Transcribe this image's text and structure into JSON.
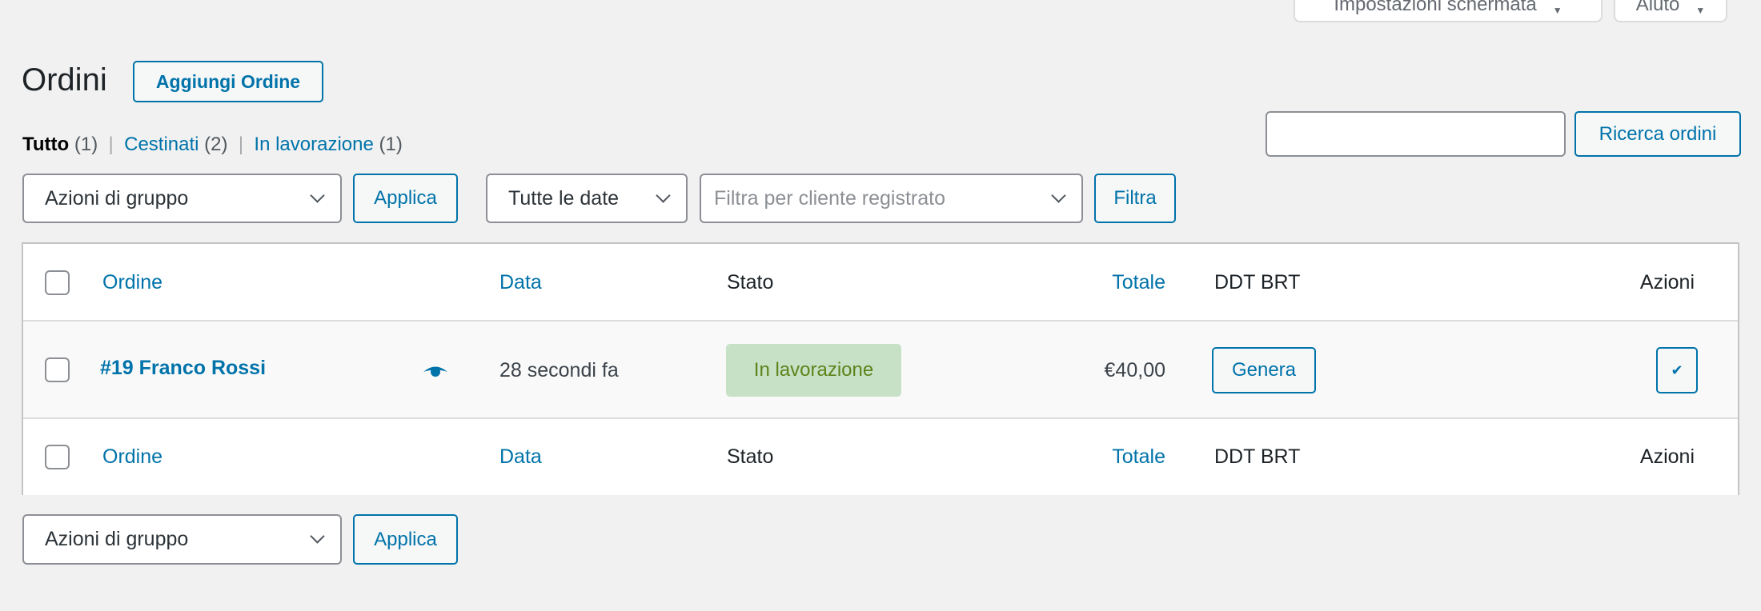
{
  "top_tabs": {
    "screen_options": "Impostazioni schermata",
    "help": "Aiuto"
  },
  "header": {
    "title": "Ordini",
    "add_button": "Aggiungi Ordine"
  },
  "views": [
    {
      "label": "Tutto",
      "count": "(1)",
      "current": true
    },
    {
      "label": "Cestinati",
      "count": "(2)"
    },
    {
      "label": "In lavorazione",
      "count": "(1)"
    }
  ],
  "search": {
    "value": "",
    "button": "Ricerca ordini"
  },
  "filters": {
    "bulk_action": "Azioni di gruppo",
    "apply": "Applica",
    "date": "Tutte le date",
    "customer_placeholder": "Filtra per cliente registrato",
    "filter": "Filtra"
  },
  "table": {
    "columns": {
      "order": "Ordine",
      "date": "Data",
      "status": "Stato",
      "total": "Totale",
      "ddt": "DDT BRT",
      "actions": "Azioni"
    },
    "rows": [
      {
        "order": "#19 Franco Rossi",
        "date": "28 secondi fa",
        "status": "In lavorazione",
        "total": "€40,00",
        "ddt_button": "Genera",
        "action_icon": "checkmark-icon"
      }
    ]
  },
  "bottom": {
    "bulk_action": "Azioni di gruppo",
    "apply": "Applica"
  },
  "colors": {
    "accent": "#0073aa",
    "status_bg": "#c6e1c6",
    "status_text": "#5b841b"
  }
}
